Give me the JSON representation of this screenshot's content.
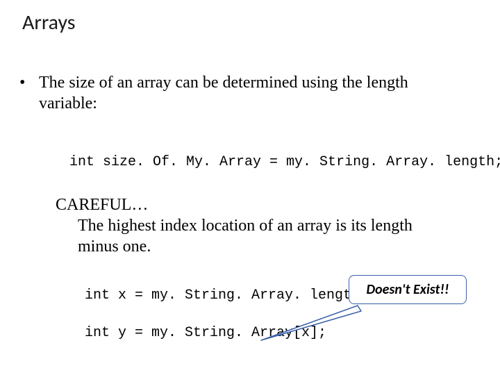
{
  "title": "Arrays",
  "bullet_text": "The size of an array can be determined using the length variable:",
  "code_line_1": "int size. Of. My. Array = my. String. Array. length;",
  "careful_label": "CAREFUL…",
  "careful_text": "The highest index location of an array is its length minus one.",
  "code_line_2": "int x = my. String. Array. length;",
  "code_line_3": "int y = my. String. Array[x];",
  "callout_text": "Doesn't Exist!!"
}
